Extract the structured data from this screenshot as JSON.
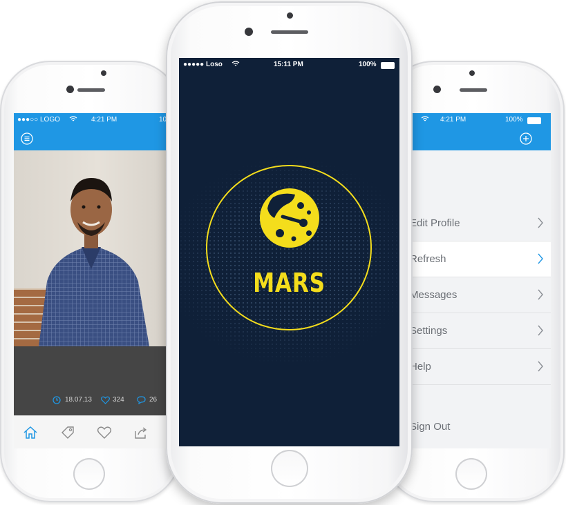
{
  "colors": {
    "accent_blue": "#1f97e4",
    "splash_bg": "#0f2038",
    "brand_yellow": "#f4dd1c",
    "caption_bg": "#454545",
    "menu_text": "#6b6f75"
  },
  "left_phone": {
    "status": {
      "carrier": "●●●○○ LOGO",
      "time": "4:21 PM",
      "battery": "10"
    },
    "post": {
      "date": "18.07.13",
      "likes": "324",
      "comments": "26"
    },
    "icons": {
      "menu": "hamburger-icon",
      "clock": "clock-icon",
      "heart": "heart-icon",
      "comment": "comment-icon",
      "home": "home-icon",
      "tag": "tag-icon",
      "favorite": "heart-outline-icon",
      "share": "share-icon"
    }
  },
  "center_phone": {
    "status": {
      "carrier": "●●●●● Loso",
      "time": "15:11 PM",
      "battery": "100%"
    },
    "splash": {
      "title": "MARS",
      "logo_icon": "planet-logo-icon"
    }
  },
  "right_phone": {
    "status": {
      "carrier": "●",
      "time": "4:21 PM",
      "battery": "100%"
    },
    "icons": {
      "add": "plus-circle-icon",
      "chevron": "chevron-right-icon"
    },
    "menu": [
      {
        "label": "Edit Profile"
      },
      {
        "label": "Refresh"
      },
      {
        "label": "Messages"
      },
      {
        "label": "Settings"
      },
      {
        "label": "Help"
      }
    ],
    "sign_out": "Sign Out"
  }
}
